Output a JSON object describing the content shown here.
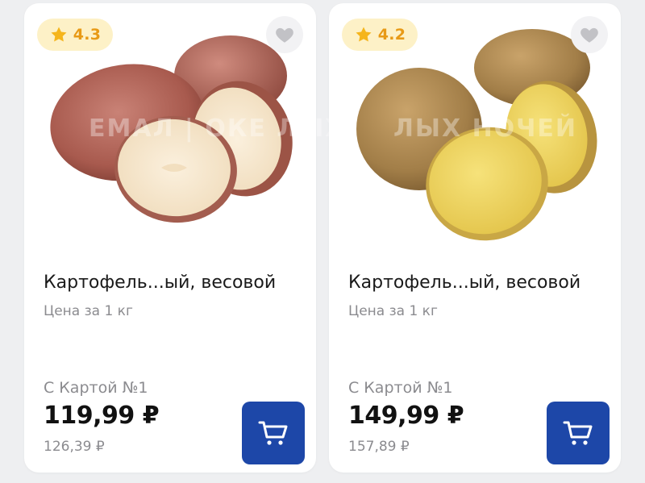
{
  "products": [
    {
      "rating": "4.3",
      "title": "Картофель...ый, весовой",
      "unit": "Цена за 1 кг",
      "card_label": "С Картой №1",
      "price": "119,99 ₽",
      "old_price": "126,39 ₽",
      "watermark": "ЕМАЛ | ОКЕ ЛЫХ НОЧЕЙ"
    },
    {
      "rating": "4.2",
      "title": "Картофель...ый, весовой",
      "unit": "Цена за 1 кг",
      "card_label": "С Картой №1",
      "price": "149,99 ₽",
      "old_price": "157,89 ₽",
      "watermark": "ЛЫХ НОЧЕЙ"
    }
  ],
  "colors": {
    "accent": "#1d47a8",
    "rating_bg": "#fdf1c7",
    "rating_star": "#f5b51c",
    "muted_text": "#8b8b8f"
  },
  "icons": {
    "rating": "star-icon",
    "favorite": "heart-icon",
    "cart": "cart-icon"
  }
}
